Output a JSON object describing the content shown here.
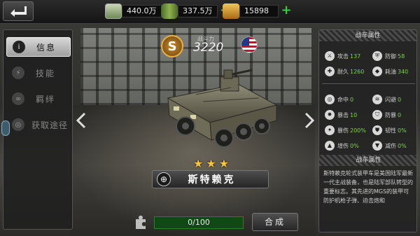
{
  "topbar": {
    "back_icon": "back-arrow-icon",
    "resources": [
      {
        "name": "cash",
        "icon": "cash-stack-icon",
        "value": "440.0万",
        "color": "#8fae7a"
      },
      {
        "name": "fuel",
        "icon": "oil-barrel-icon",
        "value": "337.5万",
        "color": "#7fa44c"
      },
      {
        "name": "gold",
        "icon": "gold-bars-icon",
        "value": "15898",
        "color": "#e0a63a"
      }
    ]
  },
  "menu": {
    "items": [
      {
        "label": "信息",
        "icon": "info-icon",
        "active": true
      },
      {
        "label": "技能",
        "icon": "lightning-icon",
        "active": false
      },
      {
        "label": "羁绊",
        "icon": "link-icon",
        "active": false
      },
      {
        "label": "获取途径",
        "icon": "location-icon",
        "active": false
      }
    ]
  },
  "unit": {
    "rank_badge": "S",
    "power_label": "战斗力",
    "power_value": "3220",
    "stars": 3,
    "name": "斯特赖克"
  },
  "progress": {
    "text": "0/100",
    "current": 0,
    "max": 100
  },
  "craft_button": "合成",
  "right_panel": {
    "title": "战车属性",
    "stats": [
      {
        "label": "攻击",
        "value": "137",
        "icon": "attack-icon"
      },
      {
        "label": "防御",
        "value": "58",
        "icon": "shield-icon"
      },
      {
        "label": "耐久",
        "value": "1260",
        "icon": "durability-icon"
      },
      {
        "label": "耗油",
        "value": "340",
        "icon": "fuel-consumption-icon"
      },
      {
        "label": "命中",
        "value": "0",
        "icon": "hit-icon"
      },
      {
        "label": "闪避",
        "value": "0",
        "icon": "dodge-icon"
      },
      {
        "label": "暴击",
        "value": "10",
        "icon": "crit-icon"
      },
      {
        "label": "防暴",
        "value": "0",
        "icon": "anti-crit-icon"
      },
      {
        "label": "暴伤",
        "value": "200%",
        "icon": "crit-damage-icon"
      },
      {
        "label": "韧性",
        "value": "0%",
        "icon": "toughness-icon"
      },
      {
        "label": "增伤",
        "value": "0%",
        "icon": "damage-bonus-icon"
      },
      {
        "label": "减伤",
        "value": "0%",
        "icon": "damage-reduction-icon"
      }
    ],
    "desc_title": "战车属性",
    "description": "斯特赖克轮式装甲车是美国陆军最新一代主战装备，也是陆军部队转型的重要标志。其先进的MGS的装甲可防护机枪子弹、迫击炮和"
  }
}
